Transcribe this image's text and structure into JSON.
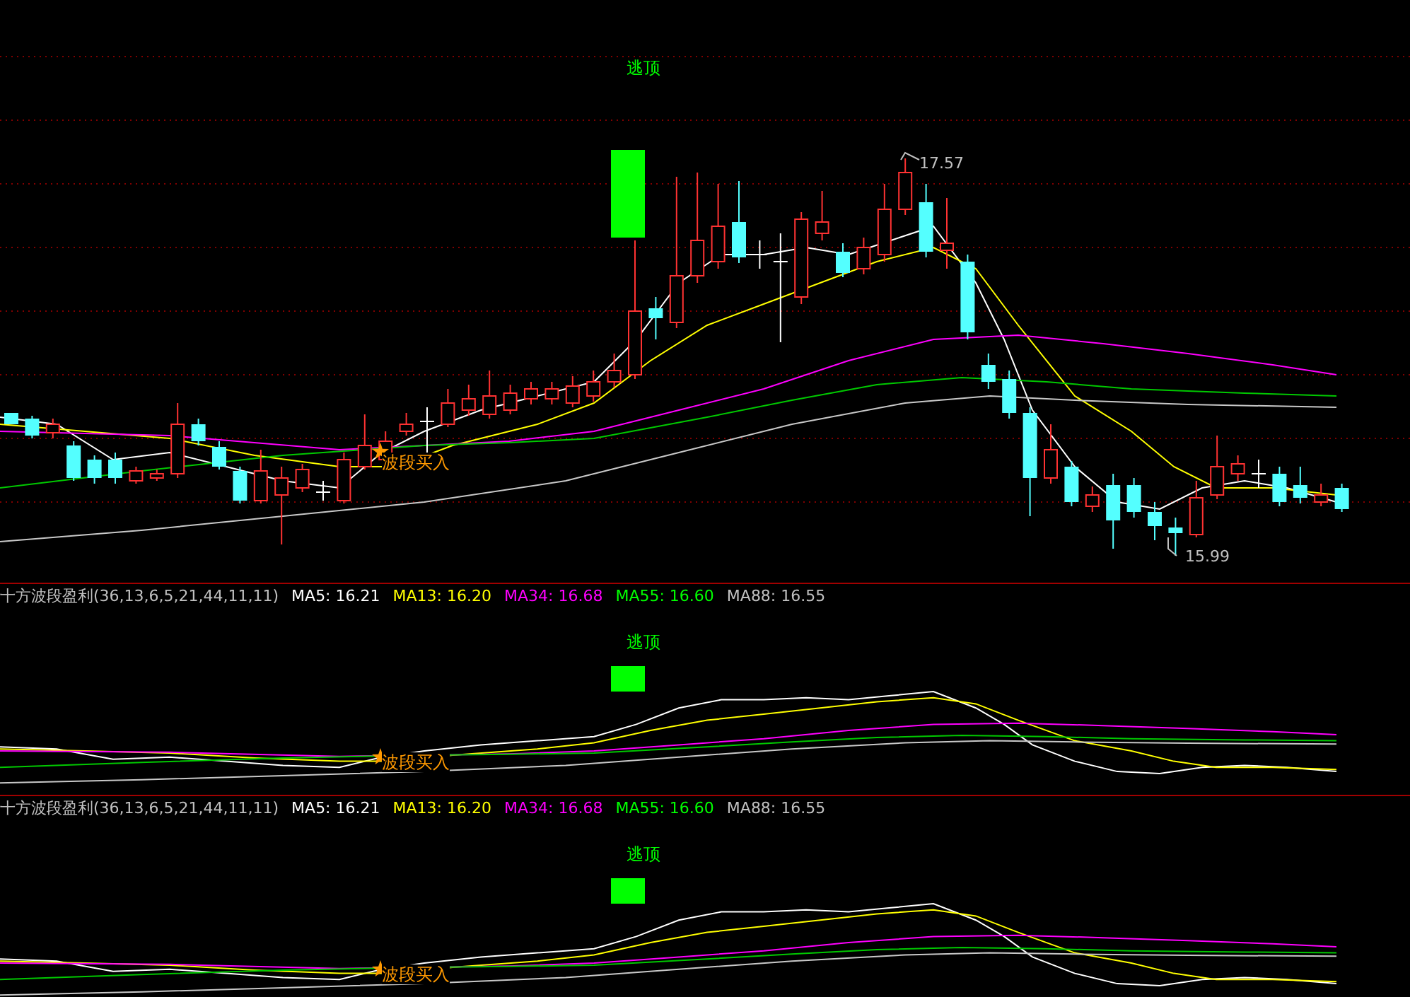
{
  "main_panel": {
    "top_signal": "逃顶",
    "buy_signal": "波段买入",
    "high_label": "17.57",
    "low_label": "15.99"
  },
  "indicator_panels": [
    {
      "legend": {
        "title": "十方波段盈利(36,13,6,5,21,44,11,11)",
        "items": [
          {
            "label": "MA5: 16.21",
            "color": "#ffffff"
          },
          {
            "label": "MA13: 16.20",
            "color": "#ffff00"
          },
          {
            "label": "MA34: 16.68",
            "color": "#ff00ff"
          },
          {
            "label": "MA55: 16.60",
            "color": "#00ff00"
          },
          {
            "label": "MA88: 16.55",
            "color": "#c0c0c0"
          }
        ]
      },
      "top_signal": "逃顶",
      "buy_signal": "波段买入"
    },
    {
      "legend": {
        "title": "十方波段盈利(36,13,6,5,21,44,11,11)",
        "items": [
          {
            "label": "MA5: 16.21",
            "color": "#ffffff"
          },
          {
            "label": "MA13: 16.20",
            "color": "#ffff00"
          },
          {
            "label": "MA34: 16.68",
            "color": "#ff00ff"
          },
          {
            "label": "MA55: 16.60",
            "color": "#00ff00"
          },
          {
            "label": "MA88: 16.55",
            "color": "#c0c0c0"
          }
        ]
      },
      "top_signal": "逃顶",
      "buy_signal": "波段买入"
    }
  ]
}
